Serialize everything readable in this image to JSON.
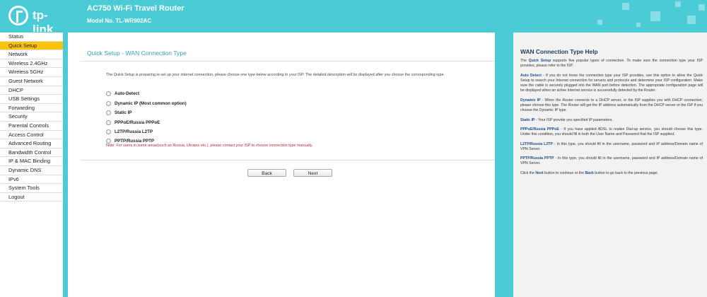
{
  "header": {
    "logo_text": "tp-link",
    "product_title": "AC750 Wi-Fi Travel Router",
    "model": "Model No. TL-WR902AC"
  },
  "sidebar": {
    "items": [
      {
        "label": "Status"
      },
      {
        "label": "Quick Setup",
        "active": true
      },
      {
        "label": "Network"
      },
      {
        "label": "Wireless 2.4GHz"
      },
      {
        "label": "Wireless 5GHz"
      },
      {
        "label": "Guest Network"
      },
      {
        "label": "DHCP"
      },
      {
        "label": "USB Settings"
      },
      {
        "label": "Forwarding"
      },
      {
        "label": "Security"
      },
      {
        "label": "Parental Controls"
      },
      {
        "label": "Access Control"
      },
      {
        "label": "Advanced Routing"
      },
      {
        "label": "Bandwidth Control"
      },
      {
        "label": "IP & MAC Binding"
      },
      {
        "label": "Dynamic DNS"
      },
      {
        "label": "IPv6"
      },
      {
        "label": "System Tools"
      },
      {
        "label": "Logout"
      }
    ]
  },
  "main": {
    "title": "Quick Setup - WAN Connection Type",
    "intro": "The Quick Setup is preparing to set up your internet connection, please choose one type below according to your ISP. The detailed description will be displayed after you choose the corresponding type.",
    "options": [
      "Auto-Detect",
      "Dynamic IP (Most common option)",
      "Static IP",
      "PPPoE/Russia PPPoE",
      "L2TP/Russia L2TP",
      "PPTP/Russia PPTP"
    ],
    "note": "Note: For users in some areas(such as Russia, Ukraine etc.), please contact your ISP to choose connection type manually.",
    "back_label": "Back",
    "next_label": "Next"
  },
  "help": {
    "title": "WAN Connection Type Help",
    "p1_pre": "The ",
    "p1_kw": "Quick Setup",
    "p1_post": " supports five popular types of connection. To make sure the connection type your ISP provides, please refer to the ISP.",
    "p2_kw": "Auto Detect",
    "p2_text": " - If you do not know the connection type your ISP provides, use this option to allow the Quick Setup to search your Internet connection for servers and protocols and determine your ISP configuration. Make sure the cable is securely plugged into the WAN port before detection. The appropriate configuration page will be displayed when an active Internet service is successfully detected by the Router.",
    "p3_kw": "Dynamic IP",
    "p3_text": " - When the Router connects to a DHCP server, or the ISP supplies you with DHCP connection, please choose this type. The Router will get the IP address automatically from the DHCP server or the ISP if you choose the Dynamic IP type.",
    "p4_kw": "Static IP",
    "p4_text": " - Your ISP provide you specified IP parameters.",
    "p5_kw": "PPPoE/Russia PPPoE",
    "p5_text": " - If you have applied ADSL to realize Dial-up service, you should choose this type. Under this condition, you should fill in both the User Name and Password that the ISP supplied.",
    "p6_kw": "L2TP/Russia L2TP",
    "p6_text": " - In this type, you should fill in the username, password and IP address/Domain name of VPN Server.",
    "p7_kw": "PPTP/Russia PPTP",
    "p7_text": " - In this type, you should fill in the username, password and IP address/Domain name of VPN Server.",
    "p8_a": "Click the ",
    "p8_kw1": "Next",
    "p8_b": " button to continue or the ",
    "p8_kw2": "Back",
    "p8_c": " button to go back to the previous page."
  },
  "colors": {
    "brand": "#4acbd6",
    "active_menu": "#ffc20e",
    "title_blue": "#3b9cc8",
    "note_red": "#b7283a"
  }
}
